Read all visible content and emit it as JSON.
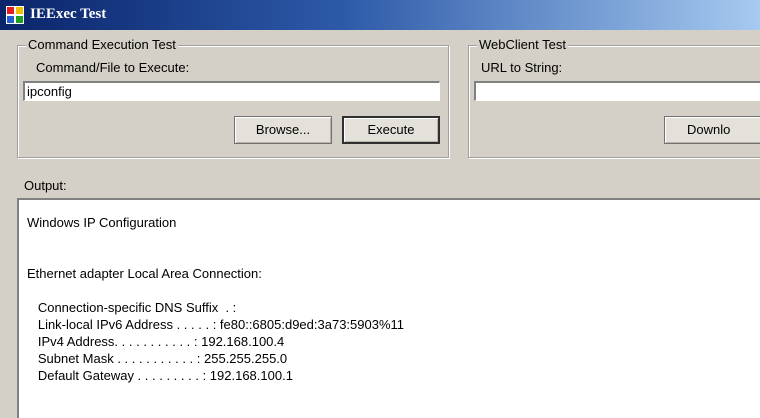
{
  "window": {
    "title": "IEExec Test"
  },
  "command_group": {
    "legend": "Command Execution Test",
    "label": "Command/File to Execute:",
    "input_value": "ipconfig",
    "browse_label": "Browse...",
    "execute_label": "Execute"
  },
  "webclient_group": {
    "legend": "WebClient Test",
    "label": "URL to String:",
    "input_value": "",
    "download_label": "Downlo"
  },
  "output": {
    "label": "Output:",
    "lines": [
      "Windows IP Configuration",
      "",
      "",
      "Ethernet adapter Local Area Connection:",
      "",
      "   Connection-specific DNS Suffix  . :",
      "   Link-local IPv6 Address . . . . . : fe80::6805:d9ed:3a73:5903%11",
      "   IPv4 Address. . . . . . . . . . . : 192.168.100.4",
      "   Subnet Mask . . . . . . . . . . . : 255.255.255.0",
      "   Default Gateway . . . . . . . . . : 192.168.100.1"
    ]
  }
}
